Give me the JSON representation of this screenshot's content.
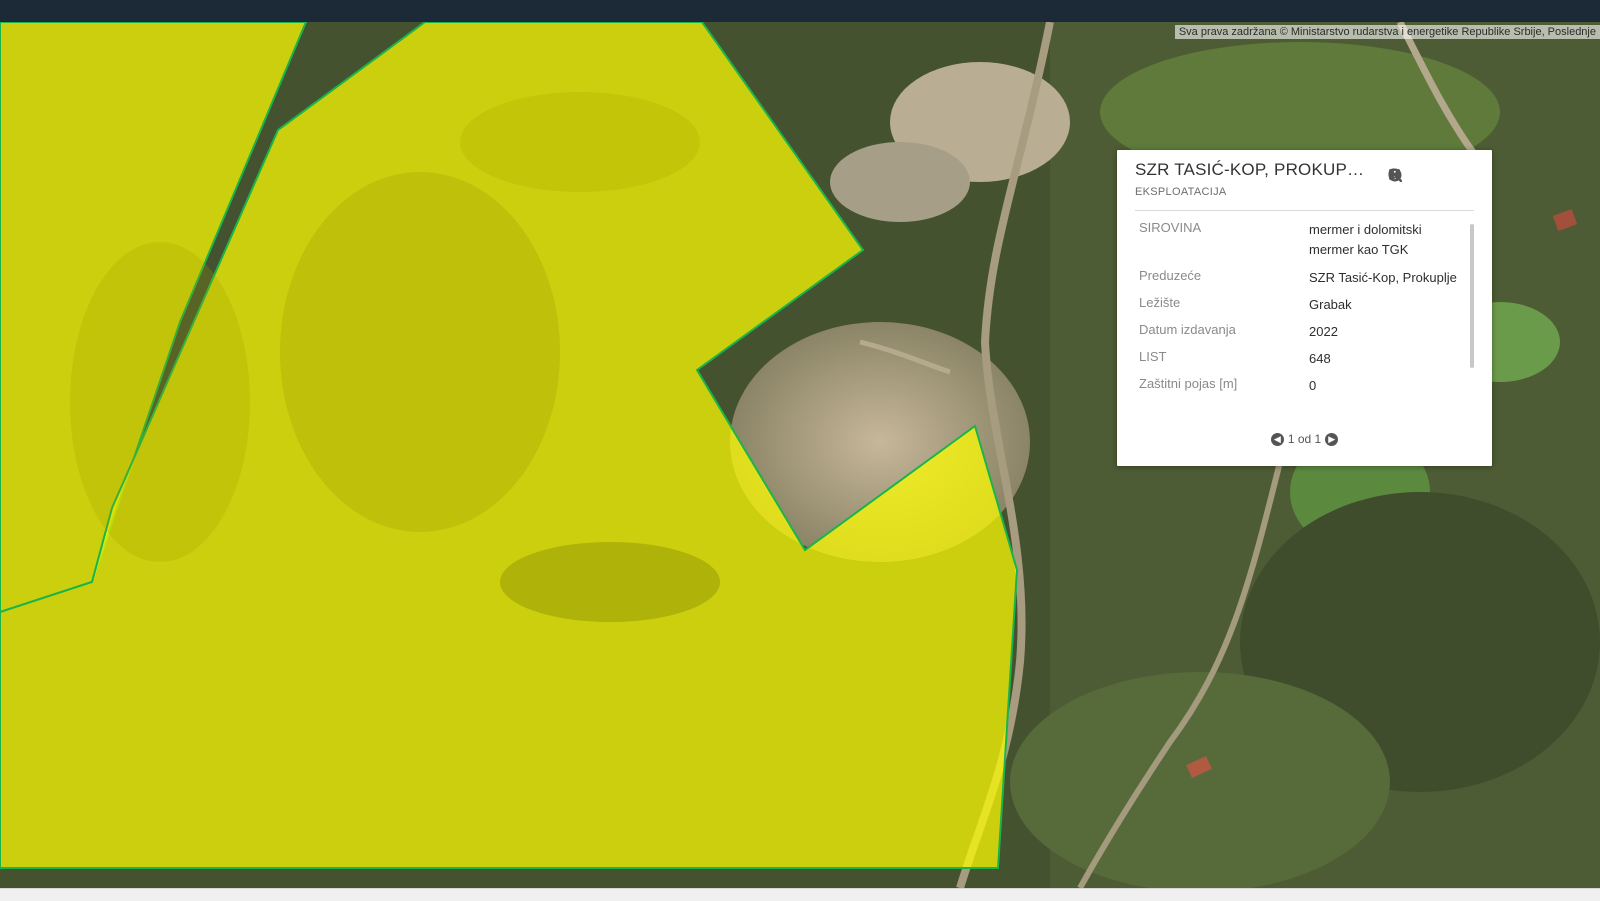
{
  "map": {
    "attribution": "Sva prava zadržana © Ministarstvo rudarstva i energetike Republike Srbije, Poslednje",
    "colors": {
      "polygon_fill": "#ffff00",
      "polygon_stroke": "#19b44a"
    }
  },
  "popup": {
    "title": "SZR TASIĆ-KOP, PROKUPL...",
    "subtitle": "EKSPLOATACIJA",
    "icons": {
      "info": "info-icon",
      "zoom": "magnifier-icon",
      "close": "close-icon"
    },
    "rows": [
      {
        "label": "SIROVINA",
        "value": "mermer i dolomitski mermer kao TGK"
      },
      {
        "label": "Preduzeće",
        "value": "SZR Tasić-Kop, Prokuplje"
      },
      {
        "label": "Ležište",
        "value": "Grabak"
      },
      {
        "label": "Datum izdavanja",
        "value": "2022"
      },
      {
        "label": "LIST",
        "value": "648"
      },
      {
        "label": "Zaštitni pojas [m]",
        "value": "0"
      }
    ],
    "pager": {
      "text": "1 od 1"
    }
  }
}
